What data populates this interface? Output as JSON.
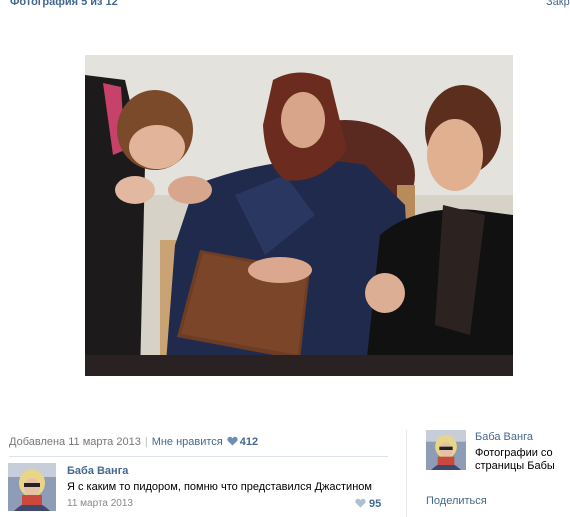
{
  "header": {
    "title": "Фотография 5 из 12",
    "close_label": "Закрыть"
  },
  "photo": {
    "icon": "photo-old-woman"
  },
  "meta": {
    "added": "Добавлена 11 марта 2013",
    "separator": "|",
    "like_label": "Мне нравится",
    "like_count": "412"
  },
  "comment": {
    "author": "Баба Ванга",
    "text": "Я с каким то пидором, помню что представился Джастином",
    "date": "11 марта 2013",
    "likes": "95"
  },
  "sidebar": {
    "owner_name": "Баба Ванга",
    "album_desc": "Фотографии со страницы Бабы",
    "share_label": "Поделиться"
  },
  "colors": {
    "link": "#45688e",
    "muted": "#777777",
    "divider": "#dde3ea"
  }
}
